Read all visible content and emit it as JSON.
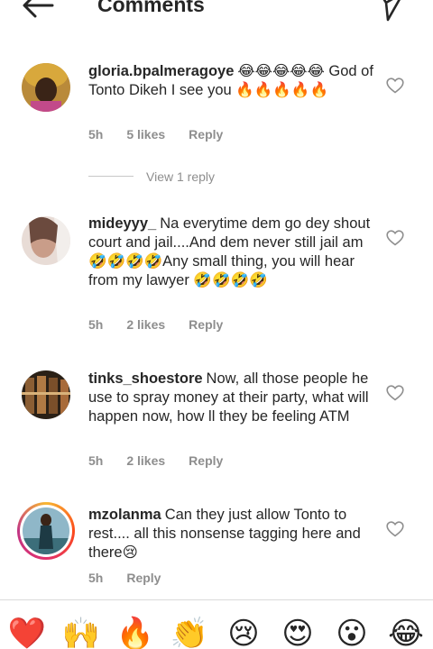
{
  "header": {
    "title": "Comments",
    "back_icon": "arrow-left-icon",
    "share_icon": "send-icon"
  },
  "comments": [
    {
      "username": "gloria.bpalmeragoye",
      "text": "😂😂😂😂😂 God of Tonto Dikeh I see you 🔥🔥🔥🔥🔥",
      "time": "5h",
      "likes": "5 likes",
      "reply_label": "Reply"
    },
    {
      "username": "mideyyy_",
      "text": "Na everytime dem go dey shout court and jail....And dem never still jail am🤣🤣🤣🤣Any small thing, you will hear from my lawyer 🤣🤣🤣🤣",
      "time": "5h",
      "likes": "2 likes",
      "reply_label": "Reply"
    },
    {
      "username": "tinks_shoestore",
      "text": "Now, all those people he use to spray money at their party, what will happen now, how ll they be feeling ATM",
      "time": "5h",
      "likes": "2 likes",
      "reply_label": "Reply"
    },
    {
      "username": "mzolanma",
      "text": "Can they just allow Tonto to rest.... all this nonsense tagging here and there😢",
      "time": "5h",
      "likes": "",
      "reply_label": "Reply"
    }
  ],
  "view_replies": {
    "label": "View 1 reply"
  },
  "emoji_bar": [
    "❤️",
    "🙌",
    "🔥",
    "👏",
    "😢",
    "😍",
    "😮",
    "😂"
  ]
}
